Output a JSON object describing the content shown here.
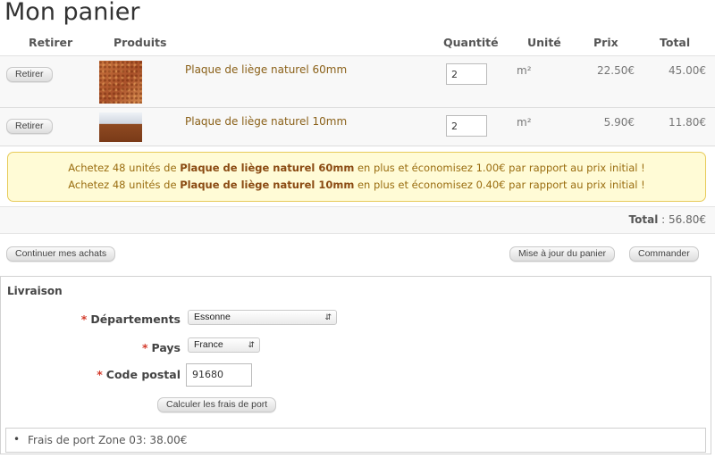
{
  "page": {
    "title": "Mon panier"
  },
  "table": {
    "headers": {
      "retirer": "Retirer",
      "produits": "Produits",
      "quantite": "Quantité",
      "unite": "Unité",
      "prix": "Prix",
      "total": "Total"
    },
    "rows": [
      {
        "remove_label": "Retirer",
        "product": "Plaque de liège naturel 60mm",
        "quantity": "2",
        "unit": "m²",
        "price": "22.50€",
        "total": "45.00€"
      },
      {
        "remove_label": "Retirer",
        "product": "Plaque de liège naturel 10mm",
        "quantity": "2",
        "unit": "m²",
        "price": "5.90€",
        "total": "11.80€"
      }
    ]
  },
  "notice": {
    "lines": [
      {
        "before": "Achetez 48 unités de ",
        "product": "Plaque de liège naturel 60mm",
        "after": " en plus et économisez 1.00€ par rapport au prix initial !"
      },
      {
        "before": "Achetez 48 unités de ",
        "product": "Plaque de liège naturel 10mm",
        "after": " en plus et économisez 0.40€ par rapport au prix initial !"
      }
    ]
  },
  "summary": {
    "total_label": "Total",
    "separator": " : ",
    "total_value": "56.80€"
  },
  "actions": {
    "continue": "Continuer mes achats",
    "update": "Mise à jour du panier",
    "order": "Commander"
  },
  "shipping": {
    "title": "Livraison",
    "required_mark": "*",
    "departement": {
      "label": "Départements",
      "value": "Essonne"
    },
    "pays": {
      "label": "Pays",
      "value": "France"
    },
    "code_postal": {
      "label": "Code postal",
      "value": "91680"
    },
    "calc_button": "Calculer les frais de port",
    "result": "Frais de port Zone 03: 38.00€"
  },
  "colors": {
    "product_link": "#8a6018",
    "required": "#d43b2c",
    "notice_bg": "#fffbd6",
    "notice_border": "#e7cb5a"
  }
}
